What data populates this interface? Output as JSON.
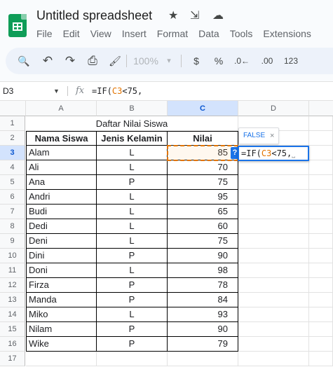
{
  "app": {
    "title": "Untitled spreadsheet",
    "icons": {
      "star": "★",
      "move": "⇲",
      "cloud": "☁"
    }
  },
  "menu": [
    "File",
    "Edit",
    "View",
    "Insert",
    "Format",
    "Data",
    "Tools",
    "Extensions"
  ],
  "toolbar": {
    "search": "🔍",
    "undo": "↶",
    "redo": "↷",
    "print": "⎙",
    "paint_format": "🖌",
    "zoom": "100%",
    "zoom_arrow": "▾",
    "currency": "$",
    "percent": "%",
    "decrease_decimal": ".0←",
    "increase_decimal": ".00",
    "more_formats": "123"
  },
  "formula_bar": {
    "cell_ref": "D3",
    "fx": "fx",
    "formula_prefix": "=IF(",
    "formula_ref": "C3",
    "formula_suffix": "<75,"
  },
  "columns": [
    "A",
    "B",
    "C",
    "D"
  ],
  "rows": [
    "1",
    "2",
    "3",
    "4",
    "5",
    "6",
    "7",
    "8",
    "9",
    "10",
    "11",
    "12",
    "13",
    "14",
    "15",
    "16",
    "17"
  ],
  "sheet": {
    "table_title": "Daftar Nilai Siswa",
    "headers": [
      "Nama Siswa",
      "Jenis Kelamin",
      "Nilai"
    ],
    "students": [
      {
        "name": "Alam",
        "gender": "L",
        "score": "85"
      },
      {
        "name": "Ali",
        "gender": "L",
        "score": "70"
      },
      {
        "name": "Ana",
        "gender": "P",
        "score": "75"
      },
      {
        "name": "Andri",
        "gender": "L",
        "score": "95"
      },
      {
        "name": "Budi",
        "gender": "L",
        "score": "65"
      },
      {
        "name": "Dedi",
        "gender": "L",
        "score": "60"
      },
      {
        "name": "Deni",
        "gender": "L",
        "score": "75"
      },
      {
        "name": "Dini",
        "gender": "P",
        "score": "90"
      },
      {
        "name": "Doni",
        "gender": "L",
        "score": "98"
      },
      {
        "name": "Firza",
        "gender": "P",
        "score": "78"
      },
      {
        "name": "Manda",
        "gender": "P",
        "score": "84"
      },
      {
        "name": "Miko",
        "gender": "L",
        "score": "93"
      },
      {
        "name": "Nilam",
        "gender": "P",
        "score": "90"
      },
      {
        "name": "Wike",
        "gender": "P",
        "score": "79"
      }
    ]
  },
  "editor": {
    "prefix": "=IF(",
    "ref": "C3",
    "suffix": "<75,",
    "cursor": "⎵"
  },
  "preview": {
    "value": "FALSE",
    "close": "×"
  },
  "help_badge": "?"
}
